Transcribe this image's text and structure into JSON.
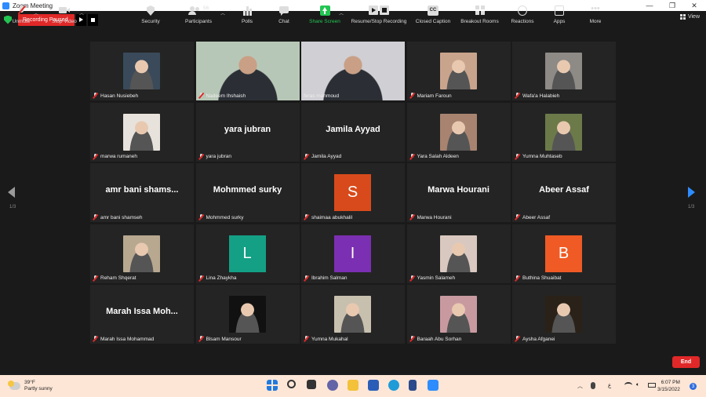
{
  "window": {
    "title": "Zoom Meeting",
    "minimize": "—",
    "maximize": "❐",
    "close": "✕"
  },
  "recording": {
    "status": "Recording Paused"
  },
  "view": {
    "label": "View"
  },
  "pager": {
    "left": "1/3",
    "right": "1/3"
  },
  "participants": [
    {
      "name": "Hasan Nusiebeh",
      "type": "photo",
      "color": "#3a4a5a"
    },
    {
      "name": "Nadeem Ihshaish",
      "type": "video",
      "color": "#b7c7b7"
    },
    {
      "name": "feras mahmoud",
      "type": "video",
      "color": "#cfcfd4",
      "active": true
    },
    {
      "name": "Mariam Faroun",
      "type": "photo",
      "color": "#c9a48d"
    },
    {
      "name": "Wafa'a Halabieh",
      "type": "photo",
      "color": "#8e8a86"
    },
    {
      "name": "marwa rumaneh",
      "type": "photo",
      "color": "#e8e2dc"
    },
    {
      "name": "yara jubran",
      "type": "name",
      "display": "yara jubran"
    },
    {
      "name": "Jamila Ayyad",
      "type": "name",
      "display": "Jamila Ayyad"
    },
    {
      "name": "Yara Salah  Aldeen",
      "type": "photo",
      "color": "#a88470"
    },
    {
      "name": "Yumna Muhtaseb",
      "type": "photo",
      "color": "#6c7a4a"
    },
    {
      "name": "amr bani shamseh",
      "type": "name",
      "display": "amr bani shams..."
    },
    {
      "name": "Mohmmed surky",
      "type": "name",
      "display": "Mohmmed surky"
    },
    {
      "name": "shaimaa abukhalil",
      "type": "letter",
      "letter": "S",
      "color": "#d84a1b"
    },
    {
      "name": "Marwa Hourani",
      "type": "name",
      "display": "Marwa Hourani"
    },
    {
      "name": "Abeer Assaf",
      "type": "name",
      "display": "Abeer Assaf"
    },
    {
      "name": "Reham Shqerat",
      "type": "photo",
      "color": "#b8a890"
    },
    {
      "name": "Lina Zhaykha",
      "type": "letter",
      "letter": "L",
      "color": "#14a085"
    },
    {
      "name": "Ibrahim Salman",
      "type": "letter",
      "letter": "I",
      "color": "#7b2fb2"
    },
    {
      "name": "Yasmin Salameh",
      "type": "photo",
      "color": "#d9c8c0"
    },
    {
      "name": "Buthina Shuaibat",
      "type": "letter",
      "letter": "B",
      "color": "#f05a24"
    },
    {
      "name": "Marah Issa Mohammad",
      "type": "name",
      "display": "Marah  Issa  Moh..."
    },
    {
      "name": "Blsam Mansour",
      "type": "photo",
      "color": "#111111"
    },
    {
      "name": "Yumna Mukahal",
      "type": "photo",
      "color": "#c8c0ae"
    },
    {
      "name": "Baraah Abu Sorhan",
      "type": "photo",
      "color": "#c89aa0"
    },
    {
      "name": "Aysha Afganei",
      "type": "photo",
      "color": "#2a2218"
    }
  ],
  "toolbar": {
    "unmute": "Unmute",
    "stop_video": "Stop Video",
    "security": "Security",
    "participants": "Participants",
    "participants_count": "56",
    "polls": "Polls",
    "chat": "Chat",
    "share_screen": "Share Screen",
    "pause_recording": "Resume/Stop Recording",
    "closed_caption": "Closed Caption",
    "breakout_rooms": "Breakout Rooms",
    "reactions": "Reactions",
    "apps": "Apps",
    "more": "More",
    "end": "End"
  },
  "taskbar": {
    "temperature": "39°F",
    "condition": "Partly sunny",
    "time": "6:07 PM",
    "date": "3/15/2022",
    "lang": "ع",
    "notifications": "3"
  },
  "colors": {
    "accent": "#2d8cff",
    "recording": "#e02828",
    "active_speaker": "#d7e54a",
    "share": "#23c552"
  }
}
